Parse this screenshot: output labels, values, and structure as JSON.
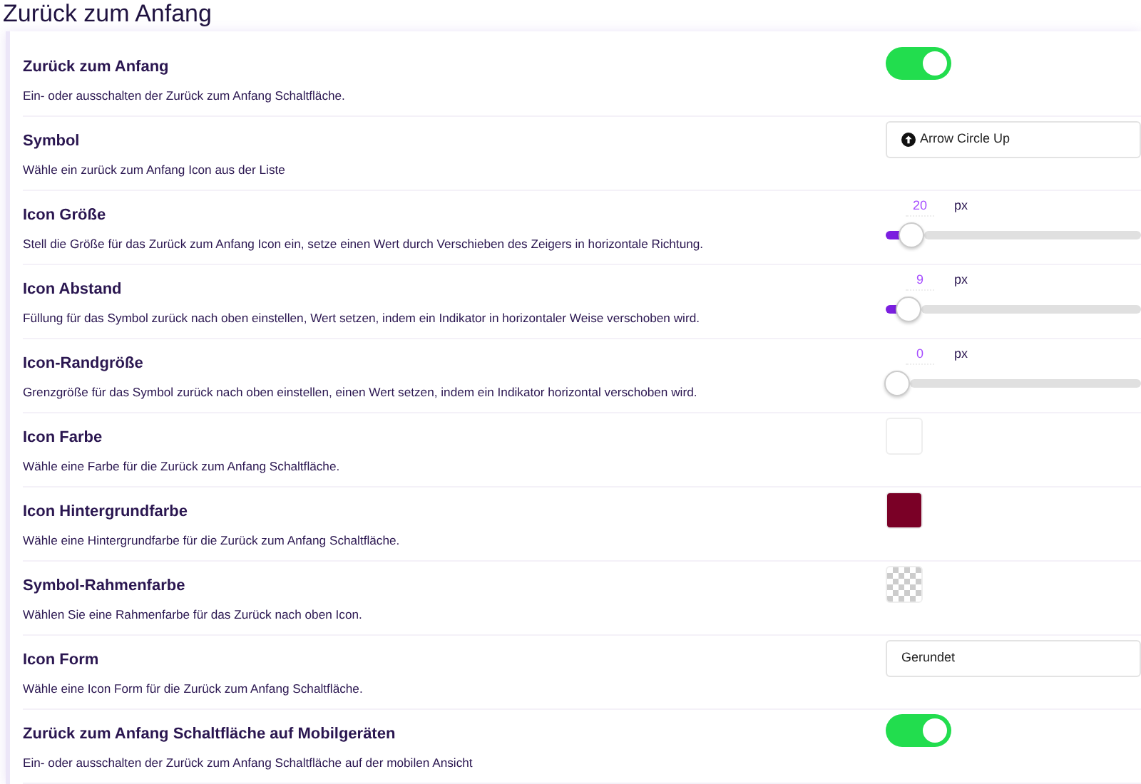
{
  "page_title": "Zurück zum Anfang",
  "settings": [
    {
      "kind": "toggle",
      "title": "Zurück zum Anfang",
      "description": "Ein- oder ausschalten der Zurück zum Anfang Schaltfläche.",
      "on": true
    },
    {
      "kind": "select",
      "title": "Symbol",
      "description": "Wähle ein zurück zum Anfang Icon aus der Liste",
      "value": "Arrow Circle Up",
      "has_icon": true
    },
    {
      "kind": "range",
      "title": "Icon Größe",
      "description": "Stell die Größe für das Zurück zum Anfang Icon ein, setze einen Wert durch Verschieben des Zeigers in horizontale Richtung.",
      "value": "20",
      "unit": "px",
      "level": 0.06
    },
    {
      "kind": "range",
      "title": "Icon Abstand",
      "description": "Füllung für das Symbol zurück nach oben einstellen, Wert setzen, indem ein Indikator in horizontaler Weise verschoben wird.",
      "value": "9",
      "unit": "px",
      "level": 0.05
    },
    {
      "kind": "range",
      "title": "Icon-Randgröße",
      "description": "Grenzgröße für das Symbol zurück nach oben einstellen, einen Wert setzen, indem ein Indikator horizontal verschoben wird.",
      "value": "0",
      "unit": "px",
      "level": 0
    },
    {
      "kind": "color",
      "title": "Icon Farbe",
      "description": "Wähle eine Farbe für die Zurück zum Anfang Schaltfläche.",
      "color": "#ffffff",
      "transparent": false
    },
    {
      "kind": "color",
      "title": "Icon Hintergrundfarbe",
      "description": "Wähle eine Hintergrundfarbe für die Zurück zum Anfang Schaltfläche.",
      "color": "#7a0026",
      "transparent": false
    },
    {
      "kind": "color",
      "title": "Symbol-Rahmenfarbe",
      "description": "Wählen Sie eine Rahmenfarbe für das Zurück nach oben Icon.",
      "transparent": true
    },
    {
      "kind": "select",
      "title": "Icon Form",
      "description": "Wähle eine Icon Form für die Zurück zum Anfang Schaltfläche.",
      "value": "Gerundet",
      "has_icon": false
    },
    {
      "kind": "toggle",
      "title": "Zurück zum Anfang Schaltfläche auf Mobilgeräten",
      "description": "Ein- oder ausschalten der Zurück zum Anfang Schaltfläche auf der mobilen Ansicht",
      "on": true
    }
  ]
}
